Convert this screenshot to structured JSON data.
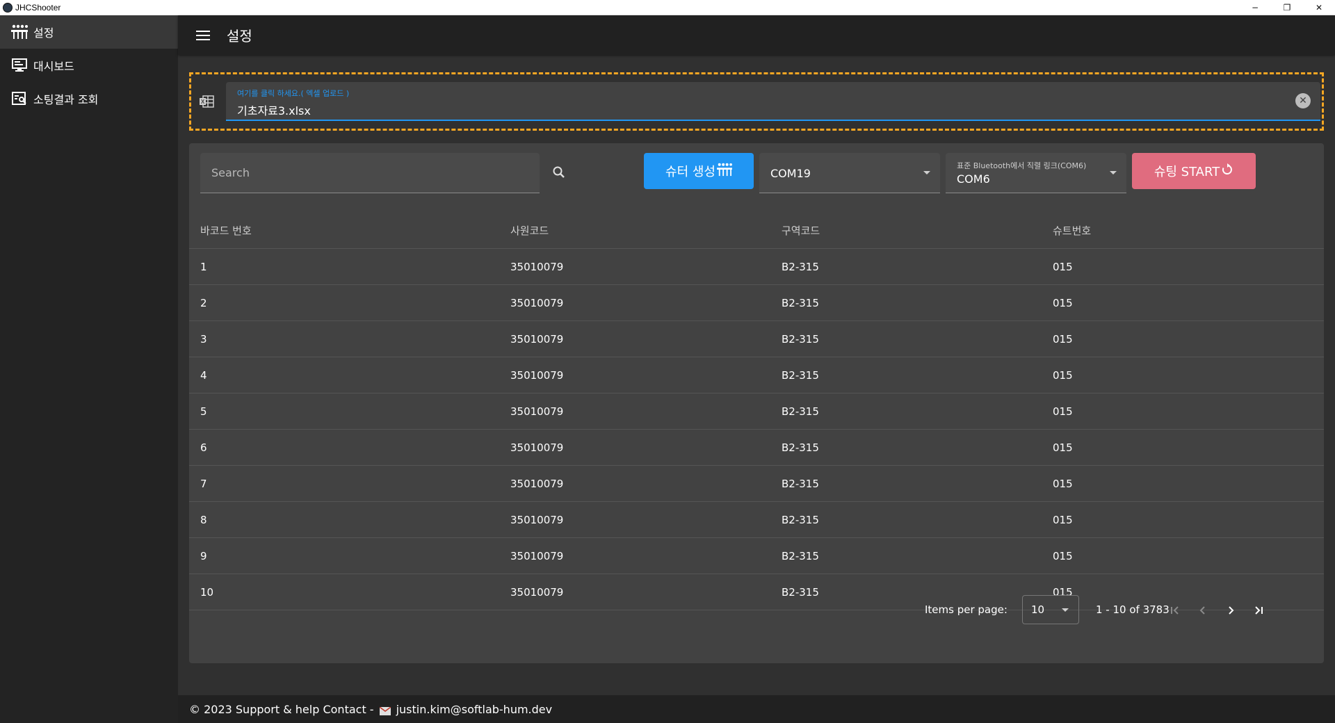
{
  "window": {
    "title": "JHCShooter",
    "minimize": "−",
    "restore": "❐",
    "close": "✕"
  },
  "sidebar": {
    "items": [
      {
        "label": "설정",
        "icon": "shooter-icon"
      },
      {
        "label": "대시보드",
        "icon": "dashboard-icon"
      },
      {
        "label": "소팅결과 조회",
        "icon": "search-list-icon"
      }
    ]
  },
  "header": {
    "title": "설정"
  },
  "upload": {
    "label": "여기를 클릭 하세요.( 엑셀 업로드 )",
    "value": "기초자료3.xlsx",
    "accent": "#f5a623"
  },
  "toolbar": {
    "search_placeholder": "Search",
    "shooter_button": "슈터 생성",
    "port1_value": "COM19",
    "port2_label": "표준 Bluetooth에서 직렬 링크(COM6)",
    "port2_value": "COM6",
    "start_button": "슈팅 START"
  },
  "table": {
    "headers": [
      "바코드 번호",
      "사원코드",
      "구역코드",
      "슈트번호"
    ],
    "rows": [
      [
        "1",
        "35010079",
        "B2-315",
        "015"
      ],
      [
        "2",
        "35010079",
        "B2-315",
        "015"
      ],
      [
        "3",
        "35010079",
        "B2-315",
        "015"
      ],
      [
        "4",
        "35010079",
        "B2-315",
        "015"
      ],
      [
        "5",
        "35010079",
        "B2-315",
        "015"
      ],
      [
        "6",
        "35010079",
        "B2-315",
        "015"
      ],
      [
        "7",
        "35010079",
        "B2-315",
        "015"
      ],
      [
        "8",
        "35010079",
        "B2-315",
        "015"
      ],
      [
        "9",
        "35010079",
        "B2-315",
        "015"
      ],
      [
        "10",
        "35010079",
        "B2-315",
        "015"
      ]
    ]
  },
  "paginator": {
    "items_label": "Items per page:",
    "per_page": "10",
    "range": "1 - 10 of 3783"
  },
  "footer": {
    "text": "© 2023 Support & help Contact - ",
    "email": "justin.kim@softlab-hum.dev"
  },
  "colors": {
    "primary": "#2196f3",
    "start": "#e06c7f"
  }
}
